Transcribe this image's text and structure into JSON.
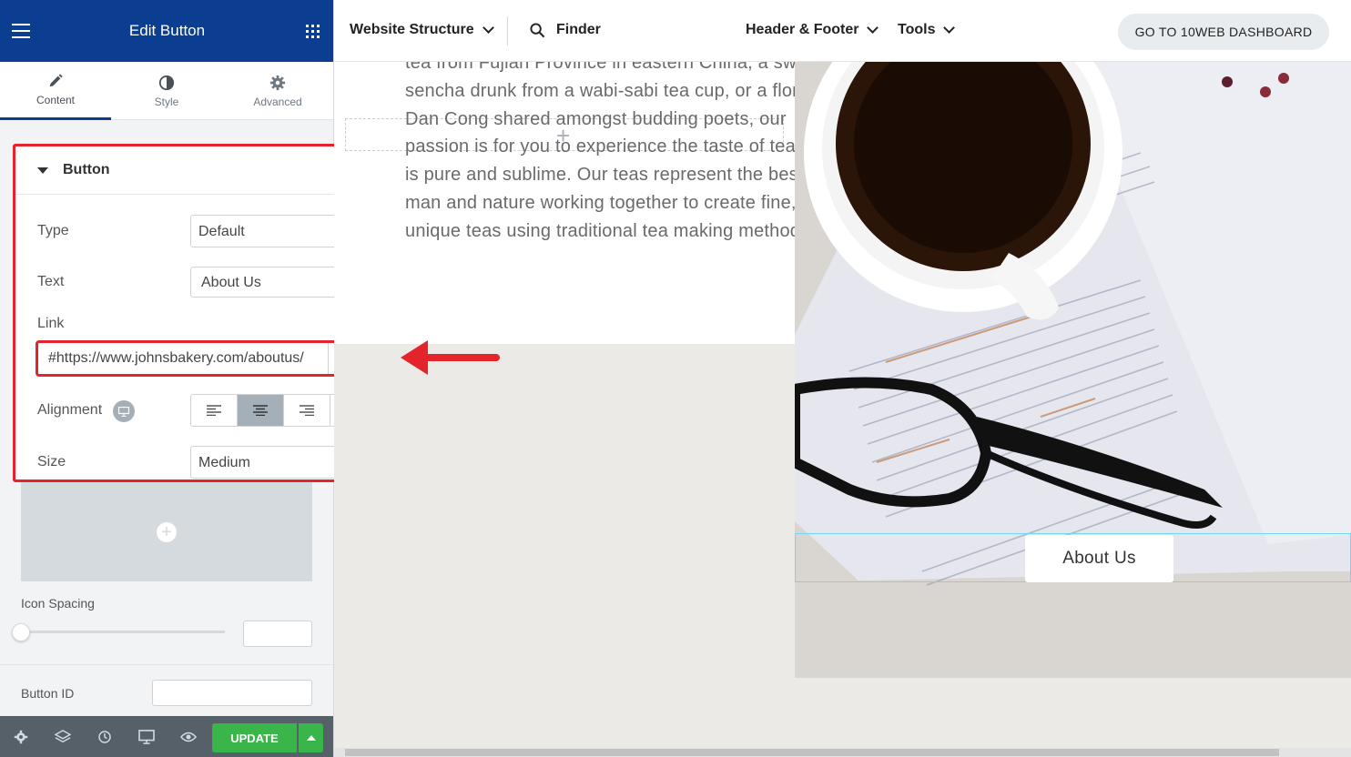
{
  "panel": {
    "title": "Edit Button",
    "tabs": [
      {
        "label": "Content"
      },
      {
        "label": "Style"
      },
      {
        "label": "Advanced"
      }
    ],
    "section_title": "Button",
    "fields": {
      "type": {
        "label": "Type",
        "value": "Default"
      },
      "text": {
        "label": "Text",
        "value": "About Us"
      },
      "link": {
        "label": "Link",
        "value": "#https://www.johnsbakery.com/aboutus/"
      },
      "alignment": {
        "label": "Alignment",
        "selected": "center"
      },
      "size": {
        "label": "Size",
        "value": "Medium"
      }
    },
    "icon_spacing_label": "Icon Spacing",
    "button_id_label": "Button ID",
    "update_label": "UPDATE"
  },
  "topbar": {
    "website_structure": "Website Structure",
    "finder": "Finder",
    "header_footer": "Header & Footer",
    "tools": "Tools",
    "dashboard_button": "GO TO 10WEB DASHBOARD"
  },
  "canvas": {
    "paragraph_lines": [
      "tea from Fujian Province in eastern China, a sweet",
      "sencha drunk from a wabi-sabi tea cup, or a floral",
      "Dan Cong shared amongst budding poets, our",
      "passion is for you to experience the taste of tea that",
      "is pure and sublime. Our teas represent the best of",
      "man and nature working together to create fine,",
      "unique teas using traditional tea making methods."
    ],
    "about_button": "About Us"
  },
  "colors": {
    "panel_header": "#0b3d91",
    "highlight_red": "#e3242b",
    "update_green": "#39b54a",
    "footer_gray": "#556068"
  }
}
